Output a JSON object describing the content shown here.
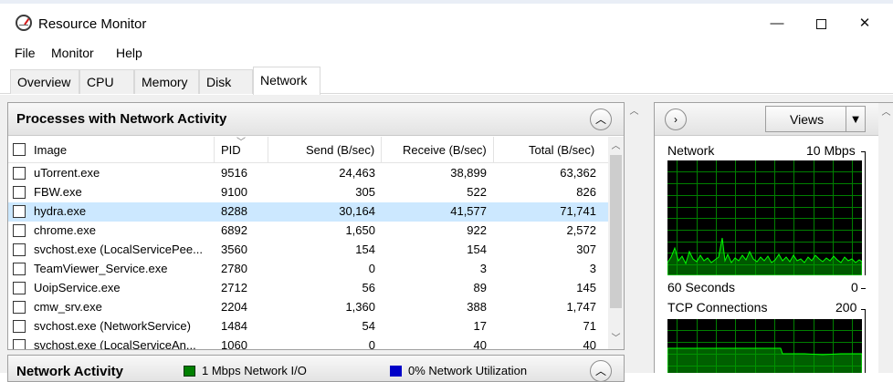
{
  "window": {
    "title": "Resource Monitor",
    "minimize": "—",
    "close": "✕"
  },
  "menu": [
    "File",
    "Monitor",
    "Help"
  ],
  "tabs": [
    {
      "label": "Overview",
      "active": false
    },
    {
      "label": "CPU",
      "active": false
    },
    {
      "label": "Memory",
      "active": false
    },
    {
      "label": "Disk",
      "active": false
    },
    {
      "label": "Network",
      "active": true
    }
  ],
  "processes": {
    "title": "Processes with Network Activity",
    "columns": [
      "Image",
      "PID",
      "Send (B/sec)",
      "Receive (B/sec)",
      "Total (B/sec)"
    ],
    "rows": [
      {
        "image": "uTorrent.exe",
        "pid": "9516",
        "send": "24,463",
        "receive": "38,899",
        "total": "63,362",
        "selected": false
      },
      {
        "image": "FBW.exe",
        "pid": "9100",
        "send": "305",
        "receive": "522",
        "total": "826",
        "selected": false
      },
      {
        "image": "hydra.exe",
        "pid": "8288",
        "send": "30,164",
        "receive": "41,577",
        "total": "71,741",
        "selected": true
      },
      {
        "image": "chrome.exe",
        "pid": "6892",
        "send": "1,650",
        "receive": "922",
        "total": "2,572",
        "selected": false
      },
      {
        "image": "svchost.exe (LocalServicePee...",
        "pid": "3560",
        "send": "154",
        "receive": "154",
        "total": "307",
        "selected": false
      },
      {
        "image": "TeamViewer_Service.exe",
        "pid": "2780",
        "send": "0",
        "receive": "3",
        "total": "3",
        "selected": false
      },
      {
        "image": "UoipService.exe",
        "pid": "2712",
        "send": "56",
        "receive": "89",
        "total": "145",
        "selected": false
      },
      {
        "image": "cmw_srv.exe",
        "pid": "2204",
        "send": "1,360",
        "receive": "388",
        "total": "1,747",
        "selected": false
      },
      {
        "image": "svchost.exe (NetworkService)",
        "pid": "1484",
        "send": "54",
        "receive": "17",
        "total": "71",
        "selected": false
      },
      {
        "image": "svchost.exe (LocalServiceAn...",
        "pid": "1060",
        "send": "0",
        "receive": "40",
        "total": "40",
        "selected": false
      }
    ]
  },
  "network_activity": {
    "title": "Network Activity",
    "legend": [
      {
        "label": "1 Mbps Network I/O",
        "color": "#008000"
      },
      {
        "label": "0% Network Utilization",
        "color": "#0000c8"
      }
    ]
  },
  "right": {
    "views_label": "Views",
    "network_graph": {
      "title": "Network",
      "max": "10 Mbps",
      "span": "60 Seconds",
      "min": "0"
    },
    "tcp_graph": {
      "title": "TCP Connections",
      "max": "200"
    }
  },
  "colors": {
    "graph_bg": "#000000",
    "grid": "#008000",
    "trace": "#00ff00",
    "selected_row": "#cce8ff"
  },
  "icons": {
    "app": "resource-monitor-icon",
    "collapse": "chevron-up-icon",
    "expand": "chevron-right-icon",
    "dropdown": "dropdown-arrow-icon"
  }
}
